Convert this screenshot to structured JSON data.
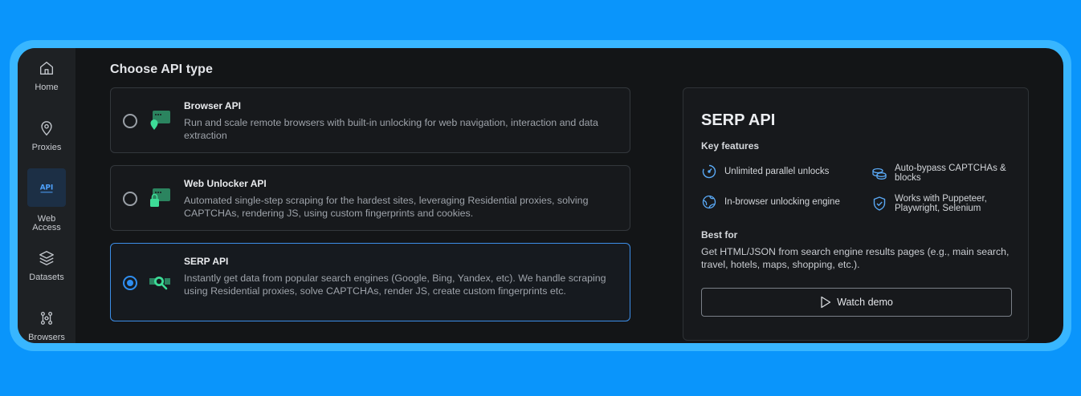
{
  "sidebar": {
    "items": [
      {
        "label": "Home",
        "icon": "home-icon"
      },
      {
        "label": "Proxies",
        "icon": "location-pin-icon"
      },
      {
        "label": "Web Access",
        "icon": "api-icon",
        "active": true,
        "icon_text": "API"
      },
      {
        "label": "Datasets",
        "icon": "layers-icon"
      },
      {
        "label": "Browsers",
        "icon": "network-icon"
      }
    ]
  },
  "main": {
    "section_title": "Choose API type",
    "options": [
      {
        "title": "Browser API",
        "description": "Run and scale remote browsers with built-in unlocking for web navigation, interaction and data extraction",
        "selected": false,
        "icon": "browser-pin-icon"
      },
      {
        "title": "Web Unlocker API",
        "description": "Automated single-step scraping for the hardest sites, leveraging Residential proxies, solving CAPTCHAs, rendering JS, using custom fingerprints and cookies.",
        "selected": false,
        "icon": "browser-lock-icon"
      },
      {
        "title": "SERP API",
        "description": "Instantly get data from popular search engines (Google, Bing, Yandex, etc). We handle scraping using Residential proxies, solve CAPTCHAs, render JS, create custom fingerprints etc.",
        "selected": true,
        "icon": "search-results-icon"
      }
    ]
  },
  "details": {
    "title": "SERP API",
    "key_features_label": "Key features",
    "features": [
      {
        "text": "Unlimited parallel unlocks",
        "icon": "speedometer-icon"
      },
      {
        "text": "Auto-bypass CAPTCHAs & blocks",
        "icon": "coins-icon"
      },
      {
        "text": "In-browser unlocking engine",
        "icon": "globe-icon"
      },
      {
        "text": "Works with Puppeteer, Playwright, Selenium",
        "icon": "shield-check-icon"
      }
    ],
    "best_for_label": "Best for",
    "best_for_text": "Get HTML/JSON from search engine results pages (e.g., main search, travel, hotels, maps, shopping, etc.).",
    "watch_demo_label": "Watch demo"
  },
  "colors": {
    "background": "#0a95fb",
    "window": "#131517",
    "accent": "#2f8ef0",
    "icon_green": "#3ddc97"
  }
}
